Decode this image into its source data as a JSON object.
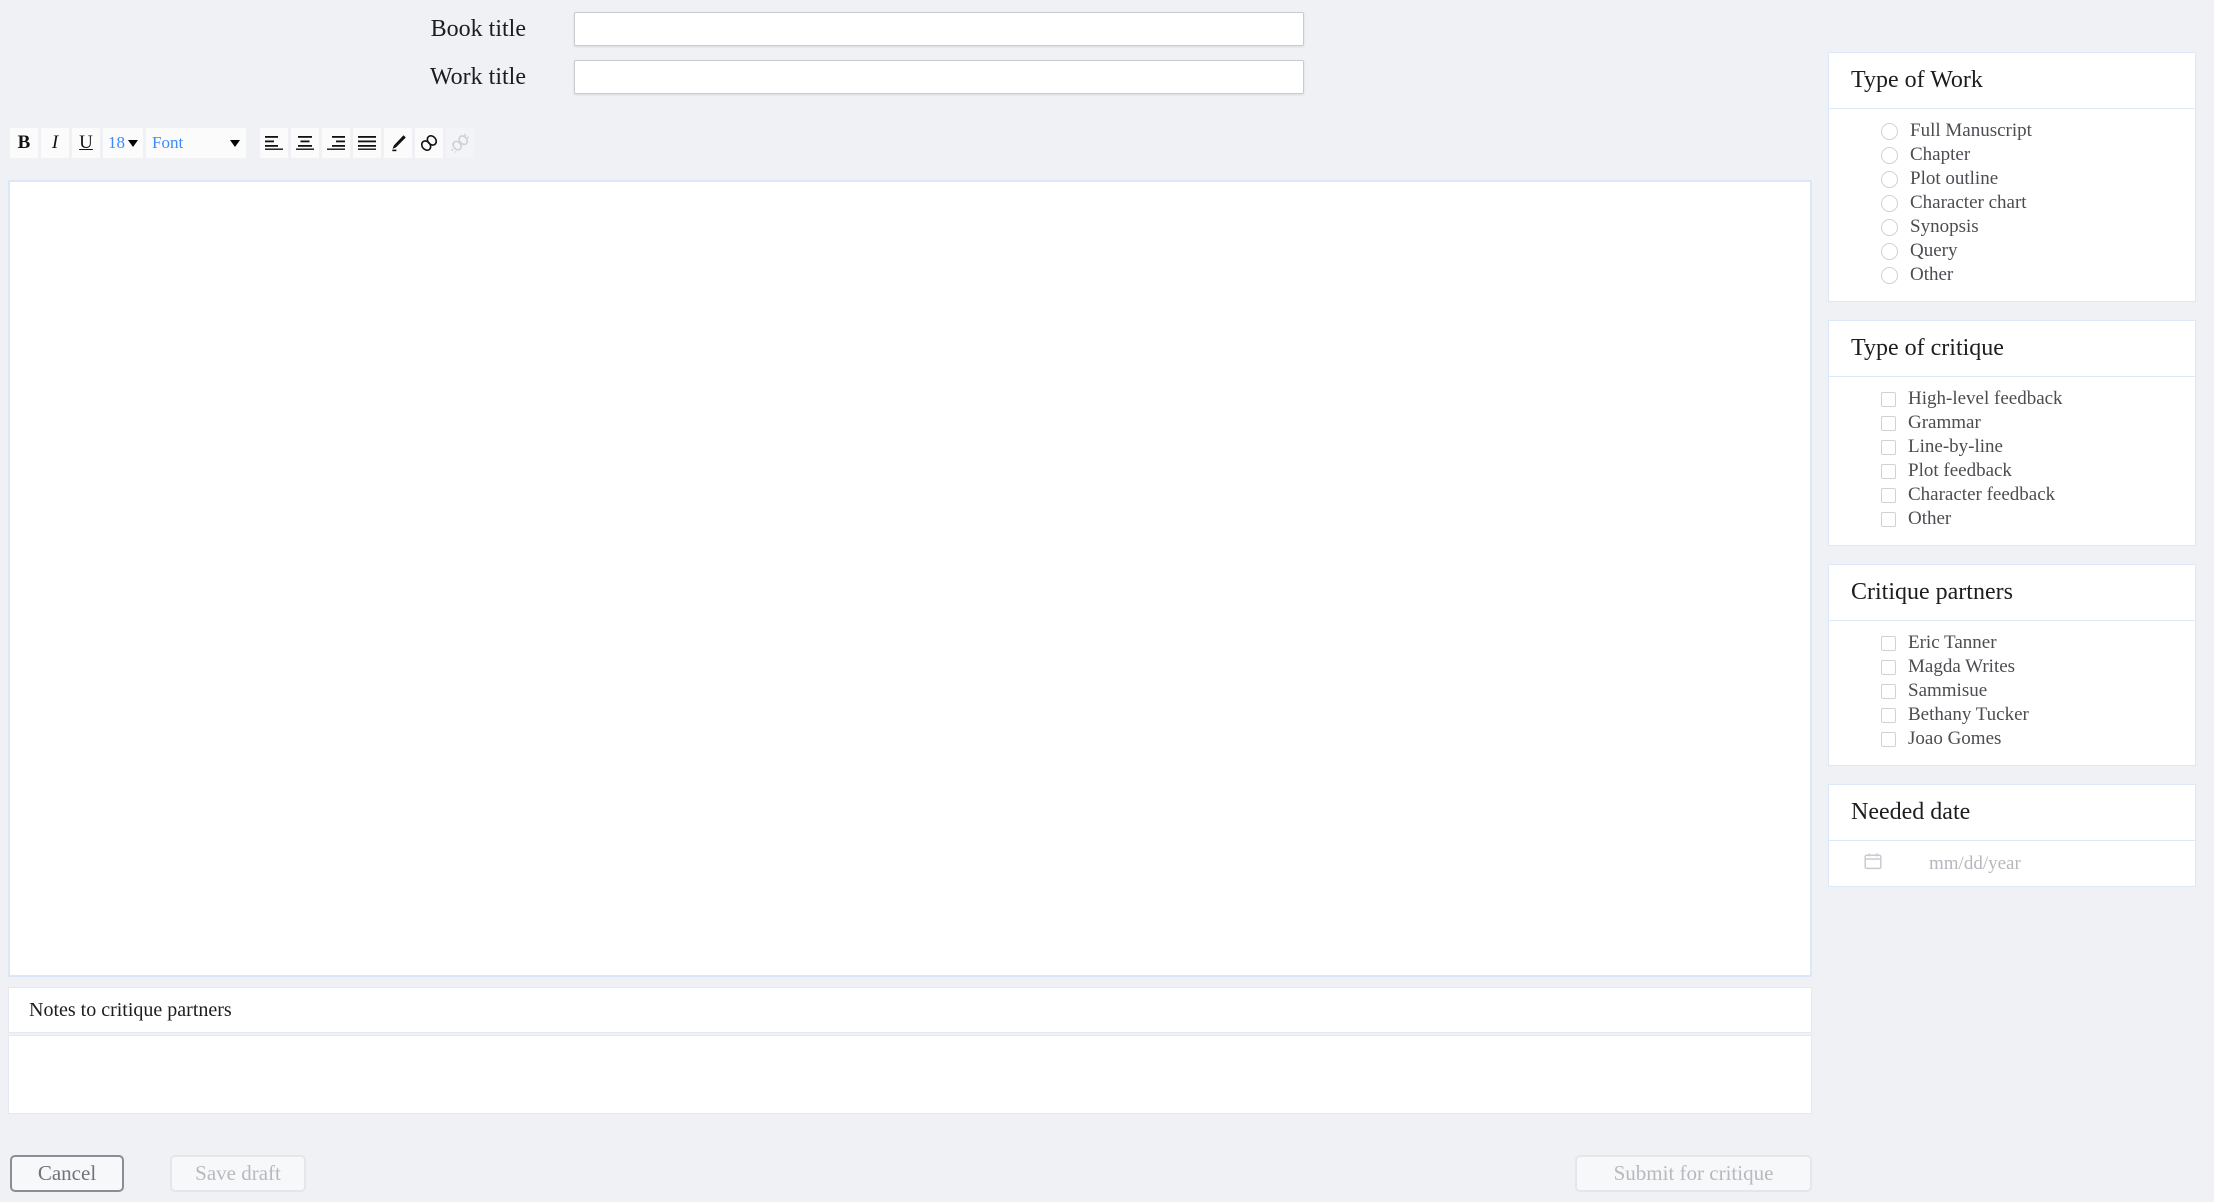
{
  "form": {
    "book_title": {
      "label": "Book title",
      "value": "",
      "placeholder": ""
    },
    "work_title": {
      "label": "Work title",
      "value": "",
      "placeholder": ""
    }
  },
  "toolbar": {
    "bold_label": "B",
    "italic_label": "I",
    "underline_label": "U",
    "font_size_value": "18",
    "font_family_value": "Font",
    "accent_color": "#3b8cf4",
    "icons": {
      "align_left": "align-left-icon",
      "align_center": "align-center-icon",
      "align_right": "align-right-icon",
      "align_justify": "align-justify-icon",
      "highlighter": "highlighter-pen-icon",
      "link": "link-icon",
      "unlink": "unlink-icon"
    }
  },
  "editor": {
    "content": "",
    "background": "#ffffff",
    "border_color": "#dbe6f7"
  },
  "notes": {
    "header": "Notes to critique partners",
    "value": "",
    "placeholder": ""
  },
  "footer": {
    "cancel_label": "Cancel",
    "save_draft_label": "Save draft",
    "submit_label": "Submit for critique"
  },
  "sidebar": {
    "panels": [
      {
        "title": "Type of Work",
        "input_type": "radio",
        "options": [
          "Full Manuscript",
          "Chapter",
          "Plot outline",
          "Character chart",
          "Synopsis",
          "Query",
          "Other"
        ]
      },
      {
        "title": "Type of critique",
        "input_type": "checkbox",
        "options": [
          "High-level feedback",
          "Grammar",
          "Line-by-line",
          "Plot feedback",
          "Character feedback",
          "Other"
        ]
      },
      {
        "title": "Critique partners",
        "input_type": "checkbox",
        "options": [
          "Eric Tanner",
          "Magda Writes",
          "Sammisue",
          "Bethany Tucker",
          "Joao Gomes"
        ]
      }
    ],
    "needed_date": {
      "title": "Needed date",
      "placeholder": "mm/dd/year",
      "value": "",
      "icon": "calendar-icon"
    }
  },
  "theme": {
    "page_background": "#eff1f5",
    "panel_border": "#dce7f7"
  }
}
